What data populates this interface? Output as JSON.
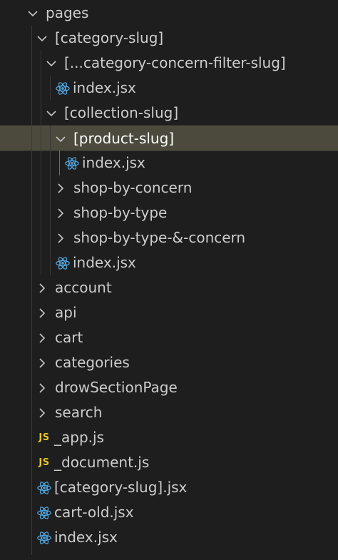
{
  "explorer": {
    "rows": [
      {
        "label": "pages",
        "kind": "folder",
        "depth": 0,
        "expanded": true,
        "selected": false,
        "icon": "chevron-down-icon"
      },
      {
        "label": "[category-slug]",
        "kind": "folder",
        "depth": 1,
        "expanded": true,
        "selected": false,
        "icon": "chevron-down-icon"
      },
      {
        "label": "[...category-concern-filter-slug]",
        "kind": "folder",
        "depth": 2,
        "expanded": true,
        "selected": false,
        "icon": "chevron-down-icon"
      },
      {
        "label": "index.jsx",
        "kind": "react",
        "depth": 3,
        "selected": false,
        "icon": "react-icon"
      },
      {
        "label": "[collection-slug]",
        "kind": "folder",
        "depth": 2,
        "expanded": true,
        "selected": false,
        "icon": "chevron-down-icon"
      },
      {
        "label": "[product-slug]",
        "kind": "folder",
        "depth": 3,
        "expanded": true,
        "selected": true,
        "icon": "chevron-down-icon"
      },
      {
        "label": "index.jsx",
        "kind": "react",
        "depth": 4,
        "selected": false,
        "icon": "react-icon"
      },
      {
        "label": "shop-by-concern",
        "kind": "folder",
        "depth": 3,
        "expanded": false,
        "selected": false,
        "icon": "chevron-right-icon"
      },
      {
        "label": "shop-by-type",
        "kind": "folder",
        "depth": 3,
        "expanded": false,
        "selected": false,
        "icon": "chevron-right-icon"
      },
      {
        "label": "shop-by-type-&-concern",
        "kind": "folder",
        "depth": 3,
        "expanded": false,
        "selected": false,
        "icon": "chevron-right-icon"
      },
      {
        "label": "index.jsx",
        "kind": "react",
        "depth": 3,
        "selected": false,
        "icon": "react-icon"
      },
      {
        "label": "account",
        "kind": "folder",
        "depth": 1,
        "expanded": false,
        "selected": false,
        "icon": "chevron-right-icon"
      },
      {
        "label": "api",
        "kind": "folder",
        "depth": 1,
        "expanded": false,
        "selected": false,
        "icon": "chevron-right-icon"
      },
      {
        "label": "cart",
        "kind": "folder",
        "depth": 1,
        "expanded": false,
        "selected": false,
        "icon": "chevron-right-icon"
      },
      {
        "label": "categories",
        "kind": "folder",
        "depth": 1,
        "expanded": false,
        "selected": false,
        "icon": "chevron-right-icon"
      },
      {
        "label": "drowSectionPage",
        "kind": "folder",
        "depth": 1,
        "expanded": false,
        "selected": false,
        "icon": "chevron-right-icon"
      },
      {
        "label": "search",
        "kind": "folder",
        "depth": 1,
        "expanded": false,
        "selected": false,
        "icon": "chevron-right-icon"
      },
      {
        "label": "_app.js",
        "kind": "js",
        "depth": 1,
        "selected": false,
        "icon": "js-file-icon",
        "badge": "JS"
      },
      {
        "label": "_document.js",
        "kind": "js",
        "depth": 1,
        "selected": false,
        "icon": "js-file-icon",
        "badge": "JS"
      },
      {
        "label": "[category-slug].jsx",
        "kind": "react",
        "depth": 1,
        "selected": false,
        "icon": "react-icon"
      },
      {
        "label": "cart-old.jsx",
        "kind": "react",
        "depth": 1,
        "selected": false,
        "icon": "react-icon"
      },
      {
        "label": "index.jsx",
        "kind": "react",
        "depth": 1,
        "selected": false,
        "icon": "react-icon"
      }
    ]
  },
  "colors": {
    "background": "#1e1e1e",
    "text": "#cccccc",
    "selected_row": "#4b4a3d",
    "react_icon": "#4fa3d9",
    "js_badge": "#e8c42a",
    "indent_guide": "#3a3a3a"
  }
}
